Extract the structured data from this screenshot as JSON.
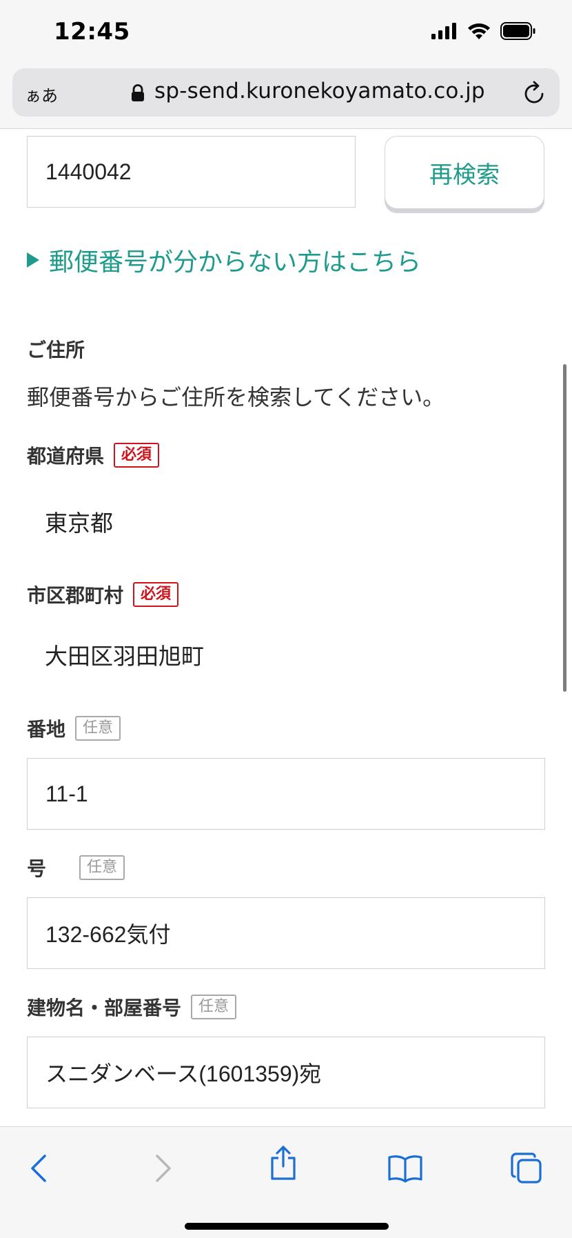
{
  "status_bar": {
    "time": "12:45"
  },
  "browser": {
    "text_size_label": "ぁあ",
    "url": "sp-send.kuronekoyamato.co.jp"
  },
  "form": {
    "zip_value": "1440042",
    "research_label": "再検索",
    "zip_help_link": "郵便番号が分からない方はこちら",
    "address_section_title": "ご住所",
    "address_helper": "郵便番号からご住所を検索してください。",
    "required_badge": "必須",
    "optional_badge": "任意",
    "prefecture": {
      "label": "都道府県",
      "value": "東京都"
    },
    "city": {
      "label": "市区郡町村",
      "value": "大田区羽田旭町"
    },
    "block": {
      "label": "番地",
      "value": "11-1"
    },
    "number": {
      "label": "号",
      "value": "132-662気付"
    },
    "building": {
      "label": "建物名・部屋番号",
      "value": "スニダンベース(1601359)宛"
    }
  },
  "colors": {
    "accent": "#1e9b8c",
    "required": "#d0121b",
    "ios_blue": "#1a6fd6"
  },
  "toolbar": {
    "icons": [
      "back-icon",
      "forward-icon",
      "share-icon",
      "bookmarks-icon",
      "tabs-icon"
    ]
  }
}
